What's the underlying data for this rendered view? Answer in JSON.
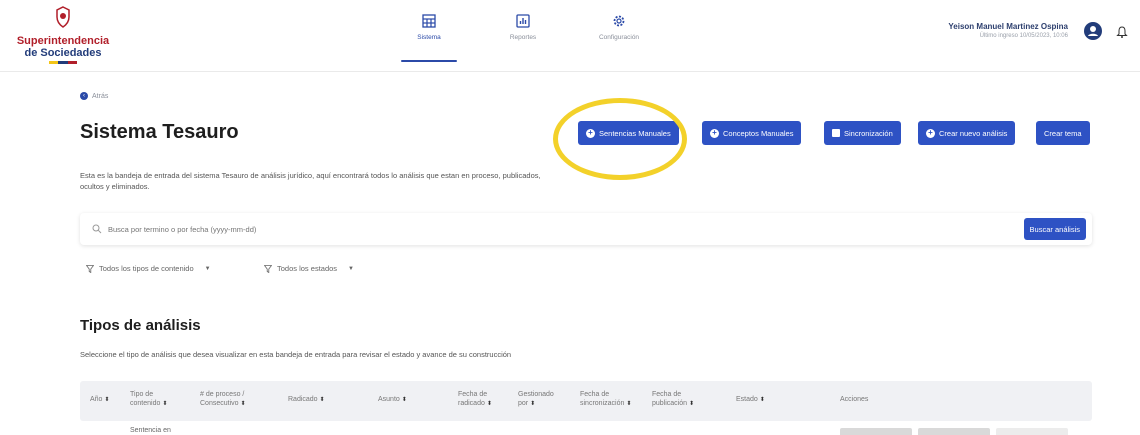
{
  "brand": {
    "line1": "Superintendencia",
    "line2": "de Sociedades"
  },
  "nav": [
    {
      "label": "Sistema",
      "icon": "grid-icon",
      "active": true
    },
    {
      "label": "Reportes",
      "icon": "chart-icon",
      "active": false
    },
    {
      "label": "Configuración",
      "icon": "gear-icon",
      "active": false
    }
  ],
  "user": {
    "name": "Yeison Manuel Martinez Ospina",
    "sub": "Último ingreso 10/05/2023, 10:06"
  },
  "back_label": "Atrás",
  "title": "Sistema Tesauro",
  "actions": {
    "sentencias": "Sentencias Manuales",
    "conceptos": "Conceptos Manuales",
    "sincronizacion": "Sincronización",
    "crear_analisis": "Crear nuevo análisis",
    "crear_tema": "Crear tema"
  },
  "description": "Esta es la bandeja de entrada del sistema Tesauro de análisis jurídico, aquí encontrará todos lo análisis que estan en proceso, publicados, ocultos y eliminados.",
  "search": {
    "placeholder": "Busca por termino o por fecha (yyyy-mm-dd)",
    "button": "Buscar análisis"
  },
  "filters": {
    "content_types": "Todos los tipos de contenido",
    "states": "Todos los estados"
  },
  "section": {
    "title": "Tipos de análisis",
    "description": "Seleccione el tipo de análisis que desea visualizar en esta bandeja de entrada para revisar el estado y avance de su construcción"
  },
  "table": {
    "headers": {
      "anio": "Año",
      "tipo_1": "Tipo de",
      "tipo_2": "contenido",
      "proceso_1": "# de proceso /",
      "proceso_2": "Consecutivo",
      "radicado": "Radicado",
      "asunto": "Asunto",
      "fecha_rad_1": "Fecha de",
      "fecha_rad_2": "radicado",
      "gest_1": "Gestionado",
      "gest_2": "por",
      "sinc_1": "Fecha de",
      "sinc_2": "sincronización",
      "pub_1": "Fecha de",
      "pub_2": "publicación",
      "estado": "Estado",
      "acciones": "Acciones"
    },
    "rows": [
      {
        "tipo": "Sentencia en"
      }
    ]
  },
  "colors": {
    "primary": "#2e52c4",
    "highlight": "#f3d12a",
    "brand_red": "#b11f2a",
    "brand_blue": "#223c7a"
  }
}
